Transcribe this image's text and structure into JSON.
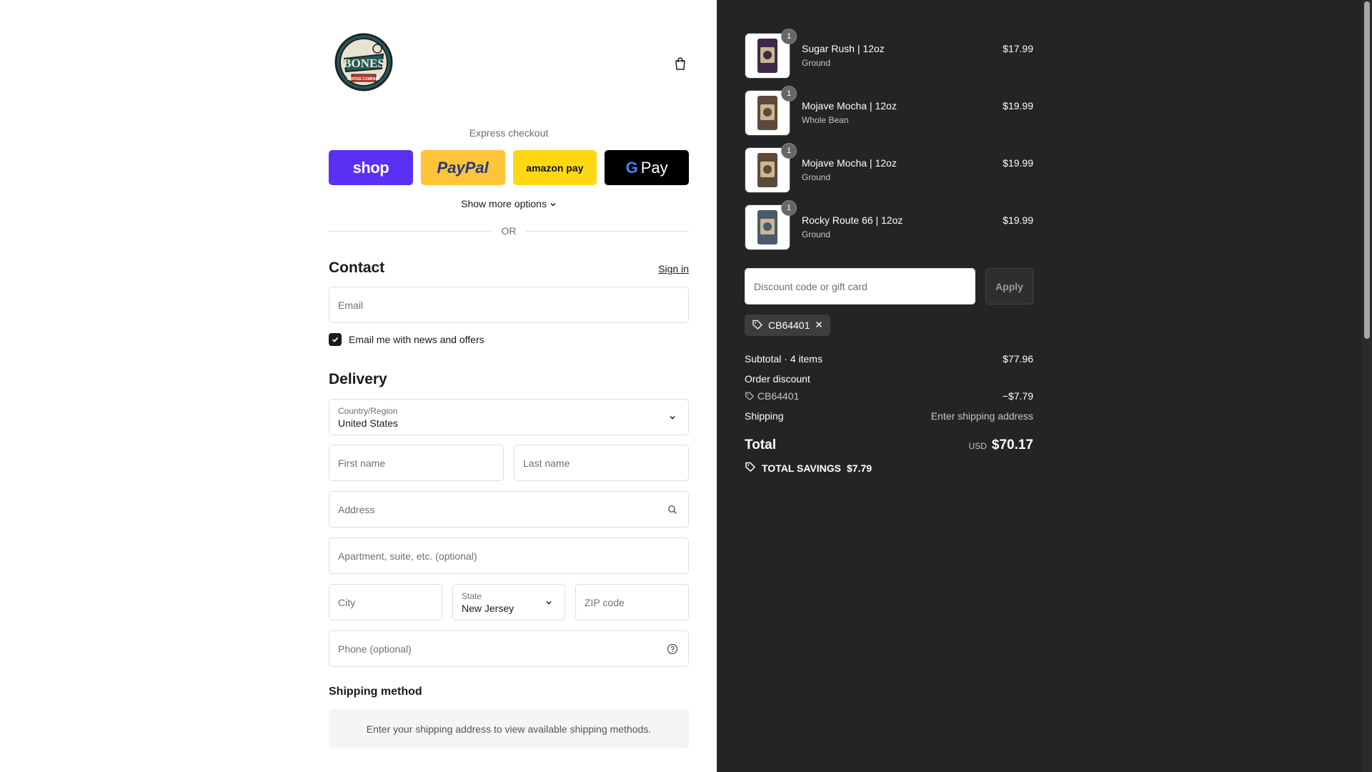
{
  "header": {
    "logo_text": "BONES",
    "logo_subtext": "COFFEE COMPANY"
  },
  "express": {
    "title": "Express checkout",
    "shop_label": "shop",
    "paypal_label": "PayPal",
    "amazon_label": "amazon pay",
    "gpay_label": "Pay",
    "more_options": "Show more options",
    "or": "OR"
  },
  "contact": {
    "title": "Contact",
    "signin": "Sign in",
    "email_placeholder": "Email",
    "newsletter_label": "Email me with news and offers",
    "newsletter_checked": true
  },
  "delivery": {
    "title": "Delivery",
    "country_label": "Country/Region",
    "country_value": "United States",
    "first_name_placeholder": "First name",
    "last_name_placeholder": "Last name",
    "address_placeholder": "Address",
    "apartment_placeholder": "Apartment, suite, etc. (optional)",
    "city_placeholder": "City",
    "state_label": "State",
    "state_value": "New Jersey",
    "zip_placeholder": "ZIP code",
    "phone_placeholder": "Phone (optional)"
  },
  "shipping_method": {
    "title": "Shipping method",
    "message": "Enter your shipping address to view available shipping methods."
  },
  "cart": {
    "items": [
      {
        "qty": "1",
        "name": "Sugar Rush | 12oz",
        "variant": "Ground",
        "price": "$17.99"
      },
      {
        "qty": "1",
        "name": "Mojave Mocha | 12oz",
        "variant": "Whole Bean",
        "price": "$19.99"
      },
      {
        "qty": "1",
        "name": "Mojave Mocha | 12oz",
        "variant": "Ground",
        "price": "$19.99"
      },
      {
        "qty": "1",
        "name": "Rocky Route 66 | 12oz",
        "variant": "Ground",
        "price": "$19.99"
      }
    ],
    "discount_placeholder": "Discount code or gift card",
    "apply_label": "Apply",
    "applied_code": "CB64401",
    "subtotal_label": "Subtotal · 4 items",
    "subtotal_value": "$77.96",
    "order_discount_label": "Order discount",
    "discount_code": "CB64401",
    "discount_value": "−$7.79",
    "shipping_label": "Shipping",
    "shipping_value": "Enter shipping address",
    "total_label": "Total",
    "currency": "USD",
    "total_value": "$70.17",
    "savings_label": "TOTAL SAVINGS",
    "savings_value": "$7.79"
  },
  "colors": {
    "shop_purple": "#5a31f4",
    "paypal_yellow": "#ffc439",
    "amazon_yellow": "#ffd814",
    "summary_bg": "#242424"
  }
}
